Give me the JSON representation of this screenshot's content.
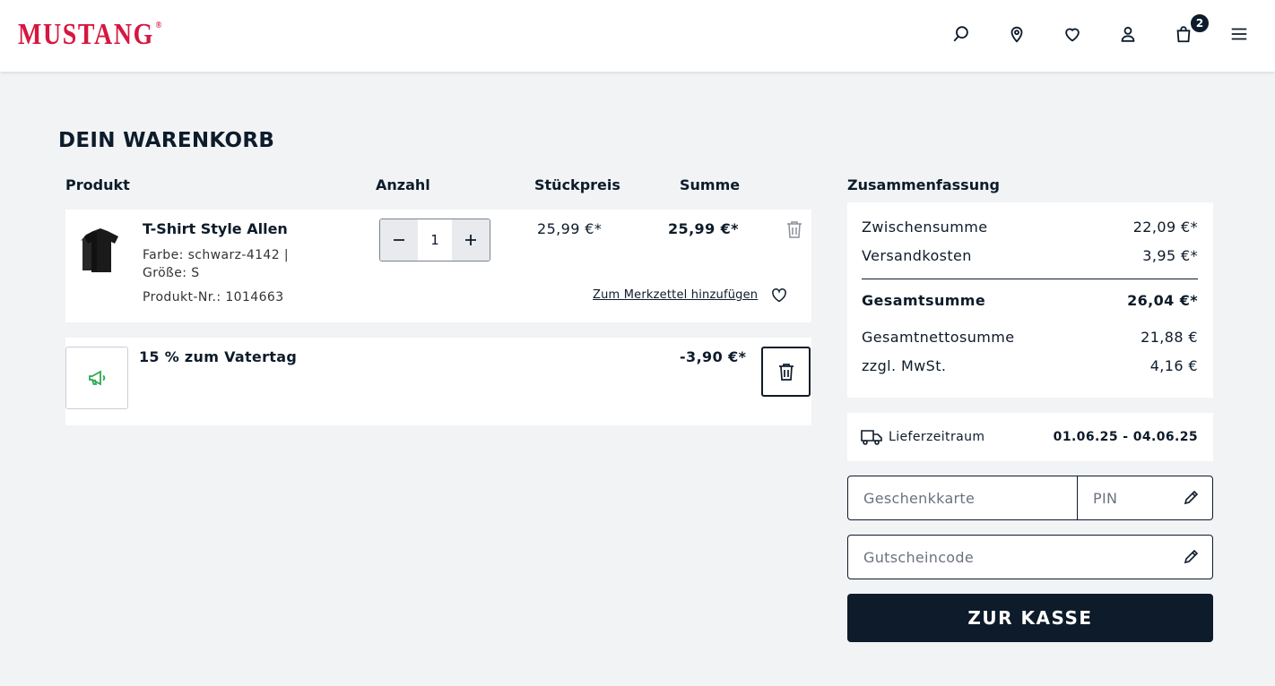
{
  "header": {
    "logo_text": "MUSTANG",
    "logo_reg": "®",
    "cart_count": "2",
    "icons": [
      "search-icon",
      "location-pin-icon",
      "heart-icon",
      "user-icon",
      "shopping-bag-icon",
      "menu-icon"
    ]
  },
  "page": {
    "title": "DEIN WARENKORB"
  },
  "columns": {
    "product": "Produkt",
    "quantity": "Anzahl",
    "unit_price": "Stückpreis",
    "total": "Summe"
  },
  "cart_item": {
    "name": "T-Shirt Style Allen",
    "color": "Farbe: schwarz-4142 |",
    "size": "Größe: S",
    "product_no": "Produkt-Nr.: 1014663",
    "quantity": "1",
    "unit_price": "25,99 €*",
    "total": "25,99 €*",
    "wishlist_label": "Zum Merkzettel hinzufügen"
  },
  "promo": {
    "name": "15 % zum Vatertag",
    "amount": "-3,90 €*"
  },
  "summary": {
    "title": "Zusammenfassung",
    "subtotal_label": "Zwischensumme",
    "subtotal_value": "22,09 €*",
    "shipping_label": "Versandkosten",
    "shipping_value": "3,95 €*",
    "grand_total_label": "Gesamtsumme",
    "grand_total_value": "26,04 €*",
    "net_total_label": "Gesamtnettosumme",
    "net_total_value": "21,88 €",
    "vat_label": "zzgl. MwSt.",
    "vat_value": "4,16 €"
  },
  "delivery": {
    "label": "Lieferzeitraum",
    "value": "01.06.25 - 04.06.25"
  },
  "gift_card": {
    "placeholder": "Geschenkkarte",
    "pin_placeholder": "PIN"
  },
  "voucher": {
    "placeholder": "Gutscheincode"
  },
  "checkout_label": "ZUR KASSE",
  "colors": {
    "brand_red": "#d6173f",
    "navy": "#0d1b2a",
    "promo_green": "#2fa84f",
    "background": "#f1f3f5"
  }
}
